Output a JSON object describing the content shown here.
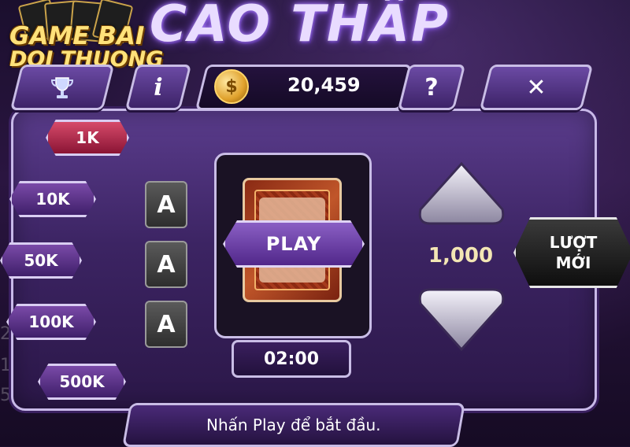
{
  "game": {
    "title": "CAO THẤP"
  },
  "logo": {
    "line1": "GAME BAI",
    "line2": "DOI THUONG"
  },
  "topbar": {
    "trophy_icon": "trophy-icon",
    "info_label": "i",
    "coin_symbol": "$",
    "balance": "20,459",
    "help_label": "?",
    "close_label": "✕"
  },
  "chips": [
    "1K",
    "10K",
    "50K",
    "100K",
    "500K"
  ],
  "selected_chip": "1K",
  "aces": [
    "A",
    "A",
    "A"
  ],
  "play": {
    "label": "PLAY"
  },
  "timer": "02:00",
  "bet": {
    "amount": "1,000"
  },
  "new_turn": {
    "line1": "LƯỢT",
    "line2": "MỚI"
  },
  "status": "Nhấn Play để bắt đầu.",
  "colors": {
    "frame": "#c9bde6",
    "panel": "#3c2463",
    "chip_selected": "#d64a6a",
    "gold": "#ffe27a"
  }
}
